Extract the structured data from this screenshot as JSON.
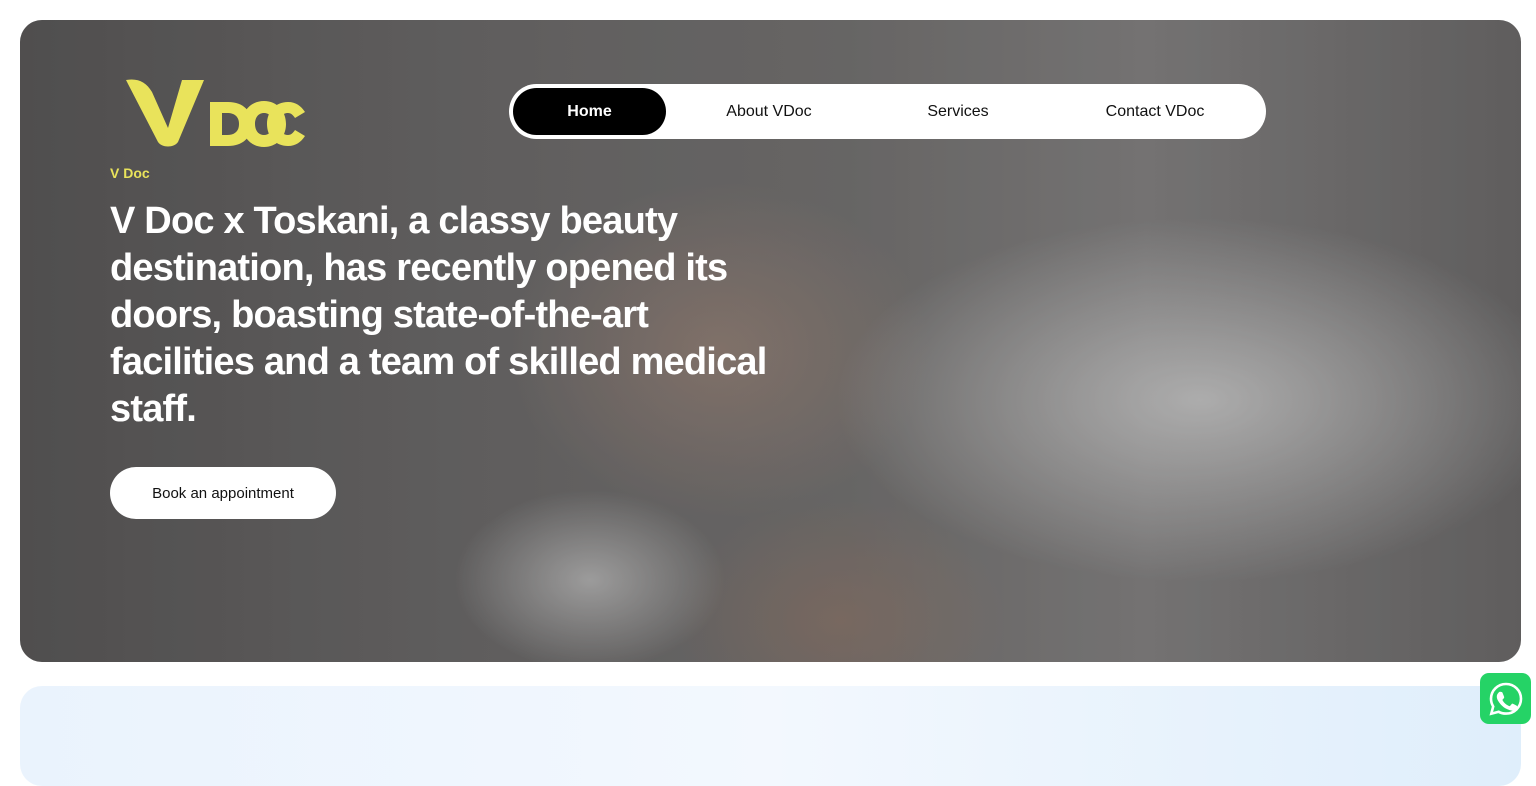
{
  "brand": {
    "logo_text": "VDoc",
    "accent_color": "#e9e35b"
  },
  "nav": {
    "items": [
      {
        "label": "Home",
        "active": true
      },
      {
        "label": "About VDoc",
        "active": false
      },
      {
        "label": "Services",
        "active": false
      },
      {
        "label": "Contact VDoc",
        "active": false
      }
    ]
  },
  "hero": {
    "eyebrow": "V Doc",
    "headline": "V Doc x Toskani, a classy beauty destination, has recently opened its doors, boasting state-of-the-art facilities and a team of skilled medical staff.",
    "cta_label": "Book an appointment"
  },
  "floating": {
    "whatsapp_icon": "whatsapp-icon",
    "whatsapp_color": "#25d366"
  }
}
